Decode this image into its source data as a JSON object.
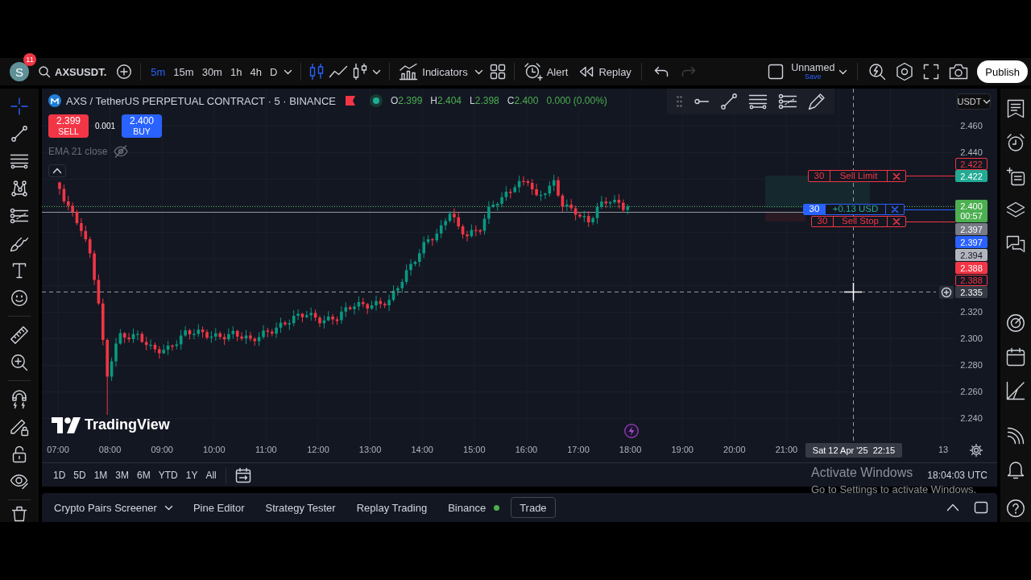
{
  "top_toolbar": {
    "avatar": {
      "initial": "S",
      "badge": "11"
    },
    "symbol": "AXSUSDT.",
    "intervals": [
      {
        "label": "5m",
        "selected": true
      },
      {
        "label": "15m",
        "selected": false
      },
      {
        "label": "30m",
        "selected": false
      },
      {
        "label": "1h",
        "selected": false
      },
      {
        "label": "4h",
        "selected": false
      },
      {
        "label": "D",
        "selected": false
      }
    ],
    "chart_types": [
      {
        "kind": "candles",
        "selected": true
      },
      {
        "kind": "line",
        "selected": false
      },
      {
        "kind": "hollow-candles",
        "selected": false
      }
    ],
    "indicators": "Indicators",
    "alert": "Alert",
    "replay": "Replay",
    "history": [
      {
        "kind": "undo",
        "disabled": false
      },
      {
        "kind": "redo",
        "disabled": true
      }
    ],
    "layout": {
      "name": "Unnamed",
      "action": "Save"
    },
    "publish": "Publish"
  },
  "left_toolbar": {
    "groups": [
      {
        "tools": [
          {
            "kind": "crosshair",
            "selected": true
          },
          {
            "kind": "trend-line",
            "selected": false
          },
          {
            "kind": "fib",
            "selected": false
          },
          {
            "kind": "pattern",
            "selected": false
          },
          {
            "kind": "projection",
            "selected": false
          },
          {
            "kind": "brush",
            "selected": false
          },
          {
            "kind": "text",
            "selected": false
          },
          {
            "kind": "emoji",
            "selected": false
          }
        ]
      },
      {
        "tools": [
          {
            "kind": "ruler",
            "selected": false
          },
          {
            "kind": "zoom",
            "selected": false
          }
        ]
      },
      {
        "tools": [
          {
            "kind": "magnet",
            "selected": false
          },
          {
            "kind": "lock-drawings",
            "selected": false
          },
          {
            "kind": "lock",
            "selected": false
          },
          {
            "kind": "hide",
            "selected": false
          }
        ]
      },
      {
        "tools": [
          {
            "kind": "remove",
            "selected": false
          }
        ]
      }
    ]
  },
  "chart": {
    "symbol_title": "AXS / TetherUS PERPETUAL CONTRACT · 5 · BINANCE",
    "market_open": true,
    "ohlc": [
      {
        "label": "O",
        "value": "2.399"
      },
      {
        "label": "H",
        "value": "2.404"
      },
      {
        "label": "L",
        "value": "2.398"
      },
      {
        "label": "C",
        "value": "2.400"
      }
    ],
    "change": "0.000 (0.00%)",
    "trade_buttons": [
      {
        "kind": "sell",
        "price": "2.399",
        "label": "SELL"
      },
      {
        "kind": "buy",
        "price": "2.400",
        "label": "BUY"
      }
    ],
    "spread": "0.001",
    "indicators": [
      {
        "label": "EMA 21 close",
        "hidden": true
      }
    ],
    "currency": "USDT",
    "price_ticks": [
      "2.460",
      "2.440",
      "2.320",
      "2.300",
      "2.280",
      "2.260",
      "2.240"
    ],
    "price_tags": [
      {
        "value": "2.422",
        "kind": "outline",
        "color": "#f23645"
      },
      {
        "value": "2.422",
        "kind": "filled",
        "color": "#22ab94"
      },
      {
        "value": "2.400",
        "countdown": "00:57",
        "kind": "filled",
        "color": "#4caf50"
      },
      {
        "value": "2.397",
        "kind": "filled",
        "color": "#787b86"
      },
      {
        "value": "2.397",
        "kind": "filled",
        "color": "#2962ff"
      },
      {
        "value": "2.394",
        "kind": "filled",
        "color": "#b2b5be"
      },
      {
        "value": "2.388",
        "kind": "filled",
        "color": "#f23645"
      },
      {
        "value": "2.388",
        "kind": "outline",
        "color": "#f23645"
      }
    ],
    "orders": [
      {
        "kind": "limit",
        "quantity": "30",
        "label": "Sell Limit"
      },
      {
        "kind": "position",
        "quantity": "30",
        "label": "+0.13 USD"
      },
      {
        "kind": "stop",
        "quantity": "30",
        "label": "Sell Stop"
      }
    ],
    "crosshair": {
      "price": "2.335",
      "time": "Sat 12 Apr '25  22:15"
    },
    "time_ticks": [
      "07:00",
      "08:00",
      "09:00",
      "10:00",
      "11:00",
      "12:00",
      "13:00",
      "14:00",
      "15:00",
      "16:00",
      "17:00",
      "18:00",
      "19:00",
      "20:00",
      "21:00"
    ],
    "next_day": "13",
    "brand": "TradingView"
  },
  "range_bar": {
    "ranges": [
      "1D",
      "5D",
      "1M",
      "3M",
      "6M",
      "YTD",
      "1Y",
      "All"
    ],
    "clock": "18:04:03 UTC"
  },
  "bottom_panel": {
    "tabs": [
      {
        "label": "Crypto Pairs Screener",
        "kind": "dropdown"
      },
      {
        "label": "Pine Editor",
        "kind": "plain"
      },
      {
        "label": "Strategy Tester",
        "kind": "plain"
      },
      {
        "label": "Replay Trading",
        "kind": "plain"
      }
    ],
    "broker": {
      "name": "Binance",
      "connected": true
    },
    "trade": "Trade"
  },
  "os_watermark": {
    "title": "Activate Windows",
    "hint": "Go to Settings to activate Windows."
  }
}
